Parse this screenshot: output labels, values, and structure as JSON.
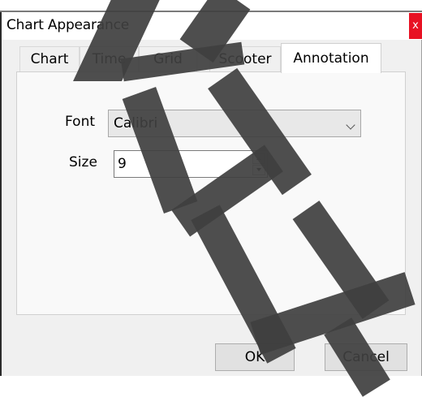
{
  "window": {
    "title": "Chart Appearance",
    "close_label": "x"
  },
  "tabs": [
    {
      "label": "Chart",
      "active": false
    },
    {
      "label": "Time",
      "active": false
    },
    {
      "label": "Grid",
      "active": false
    },
    {
      "label": "Scooter",
      "active": false
    },
    {
      "label": "Annotation",
      "active": true
    }
  ],
  "form": {
    "font_label": "Font",
    "font_value": "Calibri",
    "size_label": "Size",
    "size_value": "9"
  },
  "buttons": {
    "ok": "OK",
    "cancel": "Cancel"
  },
  "colors": {
    "close": "#e81123",
    "client_bg": "#f0f0f0",
    "watermark": "#3f3f3f"
  }
}
